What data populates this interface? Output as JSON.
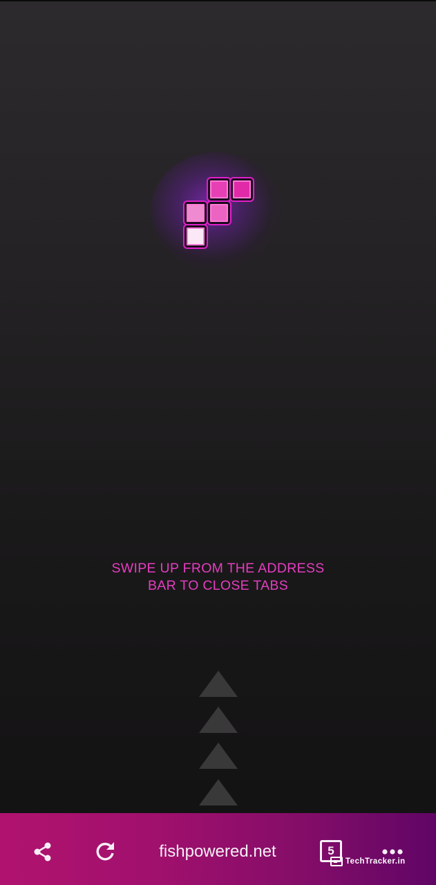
{
  "hint": {
    "line1": "SWIPE UP FROM THE ADDRESS",
    "line2": "BAR TO CLOSE TABS"
  },
  "bottom_bar": {
    "share_icon": "share-icon",
    "reload_icon": "reload-icon",
    "url": "fishpowered.net",
    "tab_count": "5",
    "more_icon": "more-icon"
  },
  "watermark": {
    "text": "TechTracker.in"
  },
  "colors": {
    "accent": "#e53dc0",
    "bar_start": "#b0136f",
    "bar_end": "#600566",
    "background": "#242224"
  }
}
